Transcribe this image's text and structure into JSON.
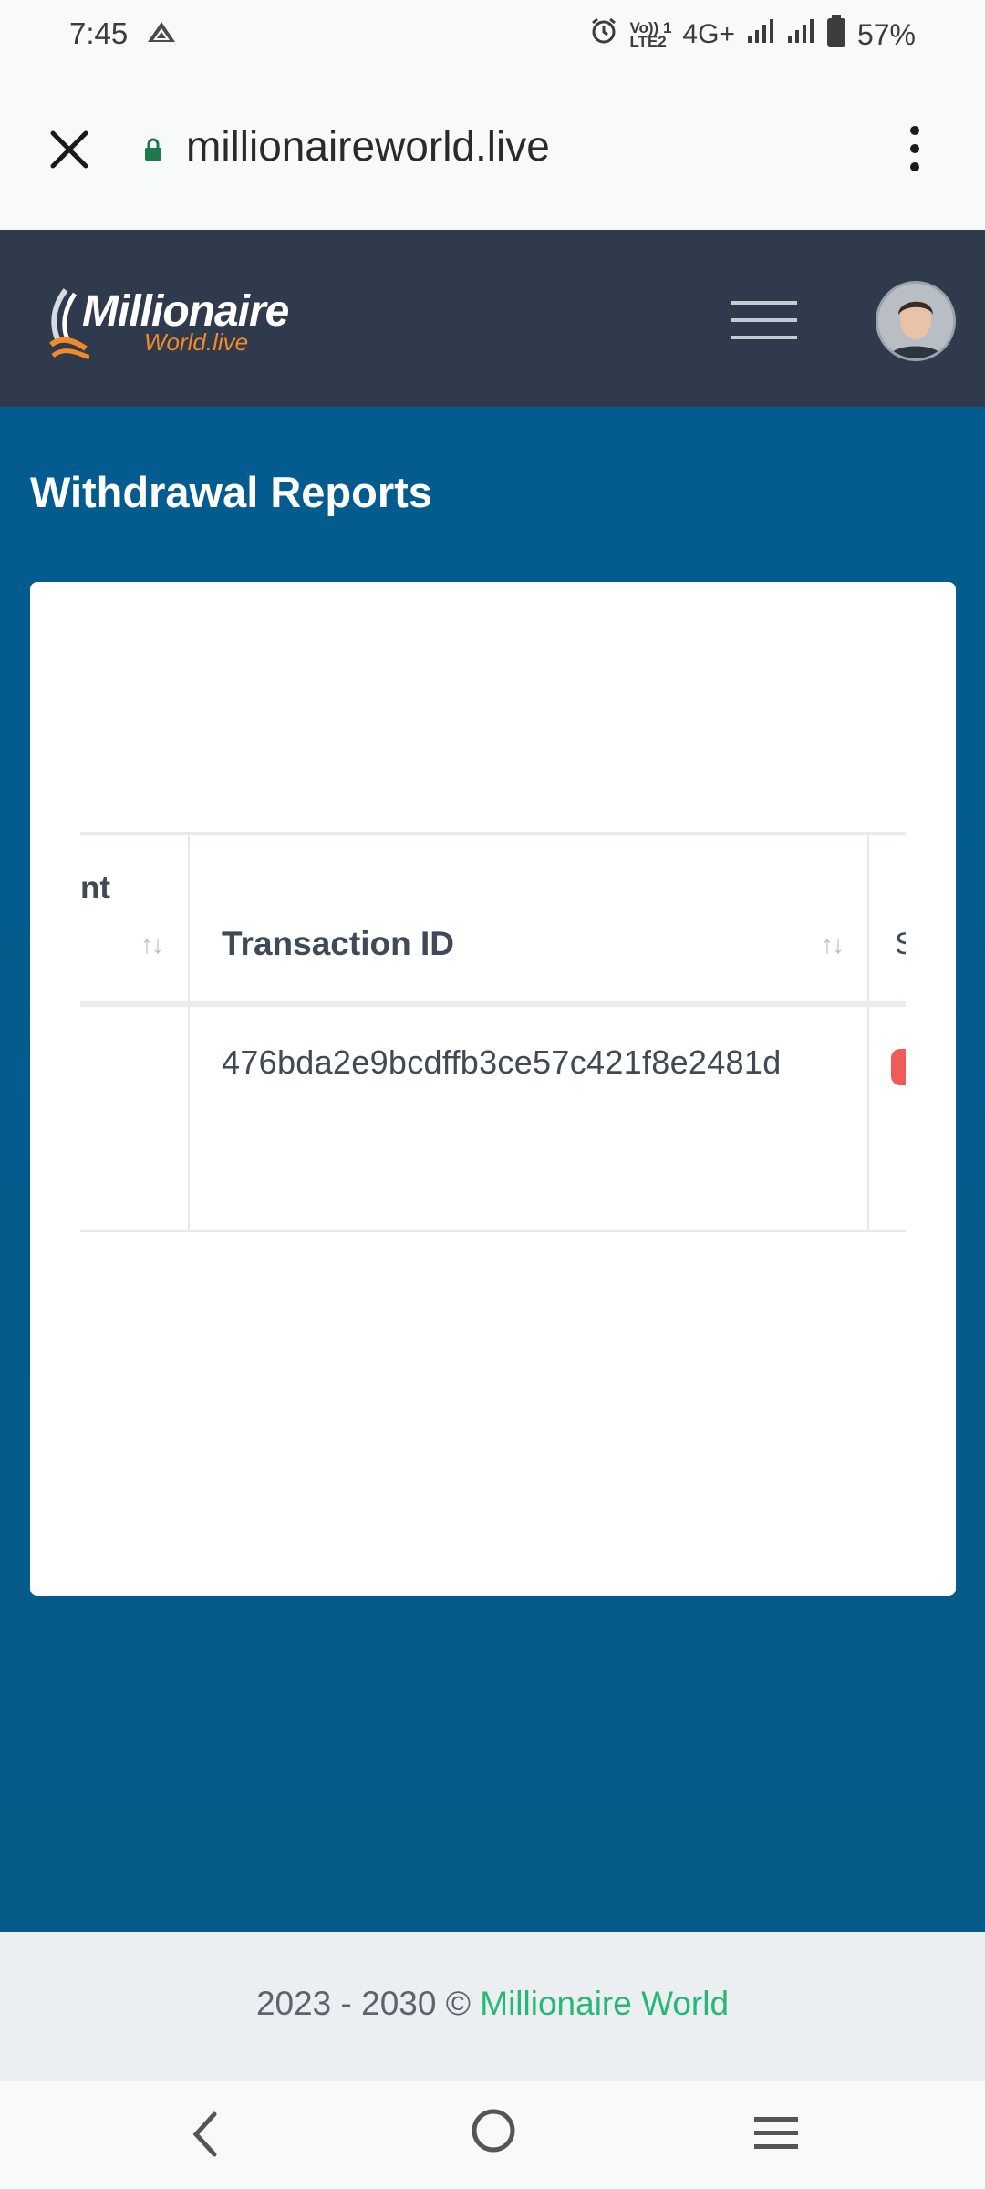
{
  "status_bar": {
    "time": "7:45",
    "network_label_top": "Vo)) 1",
    "network_label_bottom": "LTE2",
    "network_type": "4G+",
    "battery_percent": "57%",
    "icons": [
      "warning-icon",
      "alarm-icon",
      "signal-icon",
      "battery-icon"
    ]
  },
  "browser": {
    "url": "millionaireworld.live",
    "icons": [
      "close-icon",
      "lock-icon",
      "more-vert-icon"
    ]
  },
  "site_header": {
    "logo_main": "Millionaire",
    "logo_sub": "World.live",
    "icons": [
      "hamburger-menu-icon",
      "avatar"
    ]
  },
  "page": {
    "title": "Withdrawal Reports",
    "table": {
      "columns": [
        {
          "label": "nt",
          "partial": true
        },
        {
          "label": "Transaction ID"
        },
        {
          "label": "S",
          "partial": true
        }
      ],
      "rows": [
        {
          "transaction_id": "476bda2e9bcdffb3ce57c421f8e2481d"
        }
      ],
      "sort_glyph": "↑↓"
    }
  },
  "footer": {
    "text": "2023 - 2030 © ",
    "link": "Millionaire World"
  },
  "colors": {
    "header_bg": "#2f3b4d",
    "main_bg": "#035b8f",
    "logo_accent": "#f08a2a",
    "link_green": "#27b878",
    "badge_red": "#ef5a5a"
  }
}
